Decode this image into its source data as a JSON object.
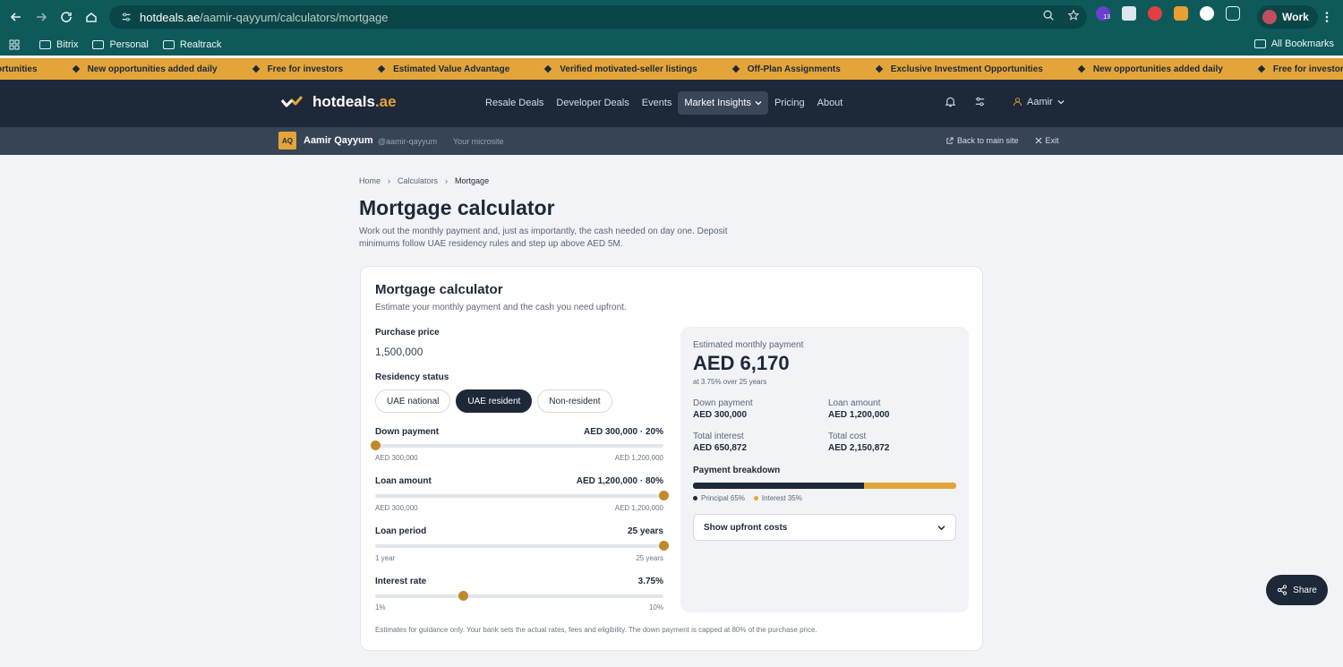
{
  "browser": {
    "url_host": "hotdeals.ae",
    "url_path": "/aamir-qayyum/calculators/mortgage",
    "ext_badge": "13",
    "profile": "Work",
    "bookmarks": [
      "Bitrix",
      "Personal",
      "Realtrack"
    ],
    "all_bookmarks": "All Bookmarks"
  },
  "ticker": {
    "items": [
      "ortunities",
      "New opportunities added daily",
      "Free for investors",
      "Estimated Value Advantage",
      "Verified motivated-seller listings",
      "Off-Plan Assignments",
      "Exclusive Investment Opportunities",
      "New opportunities added daily",
      "Free for investors"
    ]
  },
  "site": {
    "logo_main": "hotdeals",
    "logo_suffix": ".ae",
    "nav": [
      "Resale Deals",
      "Developer Deals",
      "Events",
      "Market Insights",
      "Pricing",
      "About"
    ],
    "user": "Aamir"
  },
  "microsite": {
    "initials": "AQ",
    "name": "Aamir Qayyum",
    "handle": "@aamir-qayyum",
    "sub": "Your microsite",
    "back": "Back to main site",
    "exit": "Exit"
  },
  "page": {
    "breadcrumb": [
      "Home",
      "Calculators",
      "Mortgage"
    ],
    "title": "Mortgage calculator",
    "description": "Work out the monthly payment and, just as importantly, the cash needed on day one. Deposit minimums follow UAE residency rules and step up above AED 5M."
  },
  "calculator": {
    "title": "Mortgage calculator",
    "subtitle": "Estimate your monthly payment and the cash you need upfront.",
    "purchase_label": "Purchase price",
    "purchase_value": "1,500,000",
    "residency_label": "Residency status",
    "residency_options": [
      "UAE national",
      "UAE resident",
      "Non-resident"
    ],
    "residency_selected": "UAE resident",
    "down_payment": {
      "label": "Down payment",
      "value": "AED 300,000 · 20%",
      "min": "AED 300,000",
      "max": "AED 1,200,000",
      "level": 0
    },
    "loan_amount": {
      "label": "Loan amount",
      "value": "AED 1,200,000 · 80%",
      "min": "AED 300,000",
      "max": "AED 1,200,000",
      "level": 1
    },
    "loan_period": {
      "label": "Loan period",
      "value": "25 years",
      "min": "1 year",
      "max": "25 years",
      "level": 1
    },
    "interest_rate": {
      "label": "Interest rate",
      "value": "3.75%",
      "min": "1%",
      "max": "10%",
      "level": 0.3056
    },
    "disclaimer": "Estimates for guidance only. Your bank sets the actual rates, fees and eligibility. The down payment is capped at 80% of the purchase price."
  },
  "result": {
    "label": "Estimated monthly payment",
    "amount": "AED 6,170",
    "note": "at 3.75% over 25 years",
    "down_payment_label": "Down payment",
    "down_payment_value": "AED 300,000",
    "loan_amount_label": "Loan amount",
    "loan_amount_value": "AED 1,200,000",
    "total_interest_label": "Total interest",
    "total_interest_value": "AED 650,872",
    "total_cost_label": "Total cost",
    "total_cost_value": "AED 2,150,872",
    "breakdown_title": "Payment breakdown",
    "principal_label": "Principal 65%",
    "interest_label": "Interest 35%",
    "principal_share": 0.65,
    "upfront_label": "Show upfront costs"
  },
  "share_label": "Share",
  "colors": {
    "navy": "#1d2838",
    "gold": "#e3a53a",
    "chrome": "#0e5a5b"
  }
}
